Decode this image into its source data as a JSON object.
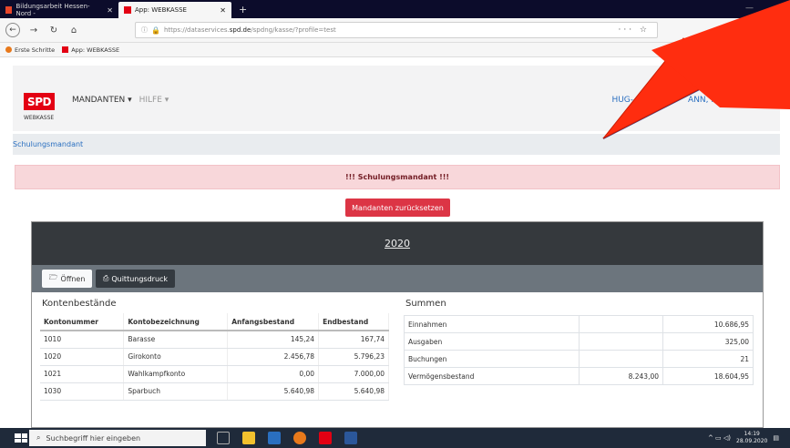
{
  "browser": {
    "tabs": [
      {
        "label": "Bildungsarbeit Hessen-Nord - ",
        "active": false
      },
      {
        "label": "App: WEBKASSE",
        "active": true
      }
    ],
    "new_tab": "+",
    "url_prefix": "https://dataservices.",
    "url_domain": "spd.de",
    "url_path": "/spdng/kasse/?profile=test",
    "url_actions": "··· ☆",
    "bookmarks": [
      {
        "label": "Erste Schritte"
      },
      {
        "label": "App: WEBKASSE"
      }
    ]
  },
  "header": {
    "logo_text": "SPD",
    "logo_sub": "WEBKASSE",
    "menu": [
      "MANDANTEN ▾",
      "HILFE ▾"
    ],
    "user_visible_left": "HUG-",
    "user_visible_right": "ANN, RAIMUND"
  },
  "breadcrumb": "Schulungsmandant",
  "alert": "!!! Schulungsmandant !!!",
  "reset_button": "Mandanten zurücksetzen",
  "year": "2020",
  "toolbar": {
    "open_label": "Öffnen",
    "print_label": "Quittungsdruck"
  },
  "kontenbestaende": {
    "title": "Kontenbestände",
    "headers": [
      "Kontonummer",
      "Kontobezeichnung",
      "Anfangsbestand",
      "Endbestand"
    ],
    "rows": [
      [
        "1010",
        "Barasse",
        "145,24",
        "167,74"
      ],
      [
        "1020",
        "Girokonto",
        "2.456,78",
        "5.796,23"
      ],
      [
        "1021",
        "Wahlkampfkonto",
        "0,00",
        "7.000,00"
      ],
      [
        "1030",
        "Sparbuch",
        "5.640,98",
        "5.640,98"
      ]
    ]
  },
  "summen": {
    "title": "Summen",
    "rows": [
      [
        "Einnahmen",
        "",
        "10.686,95"
      ],
      [
        "Ausgaben",
        "",
        "325,00"
      ],
      [
        "Buchungen",
        "",
        "21"
      ],
      [
        "Vermögensbestand",
        "8.243,00",
        "18.604,95"
      ]
    ]
  },
  "taskbar": {
    "search_placeholder": "Suchbegriff hier eingeben",
    "time": "14:19",
    "date": "28.09.2020"
  },
  "colors": {
    "spd_red": "#e30013",
    "alert_bg": "#f8d7da",
    "reset_red": "#dc3545",
    "link_blue": "#2a6fc0"
  }
}
